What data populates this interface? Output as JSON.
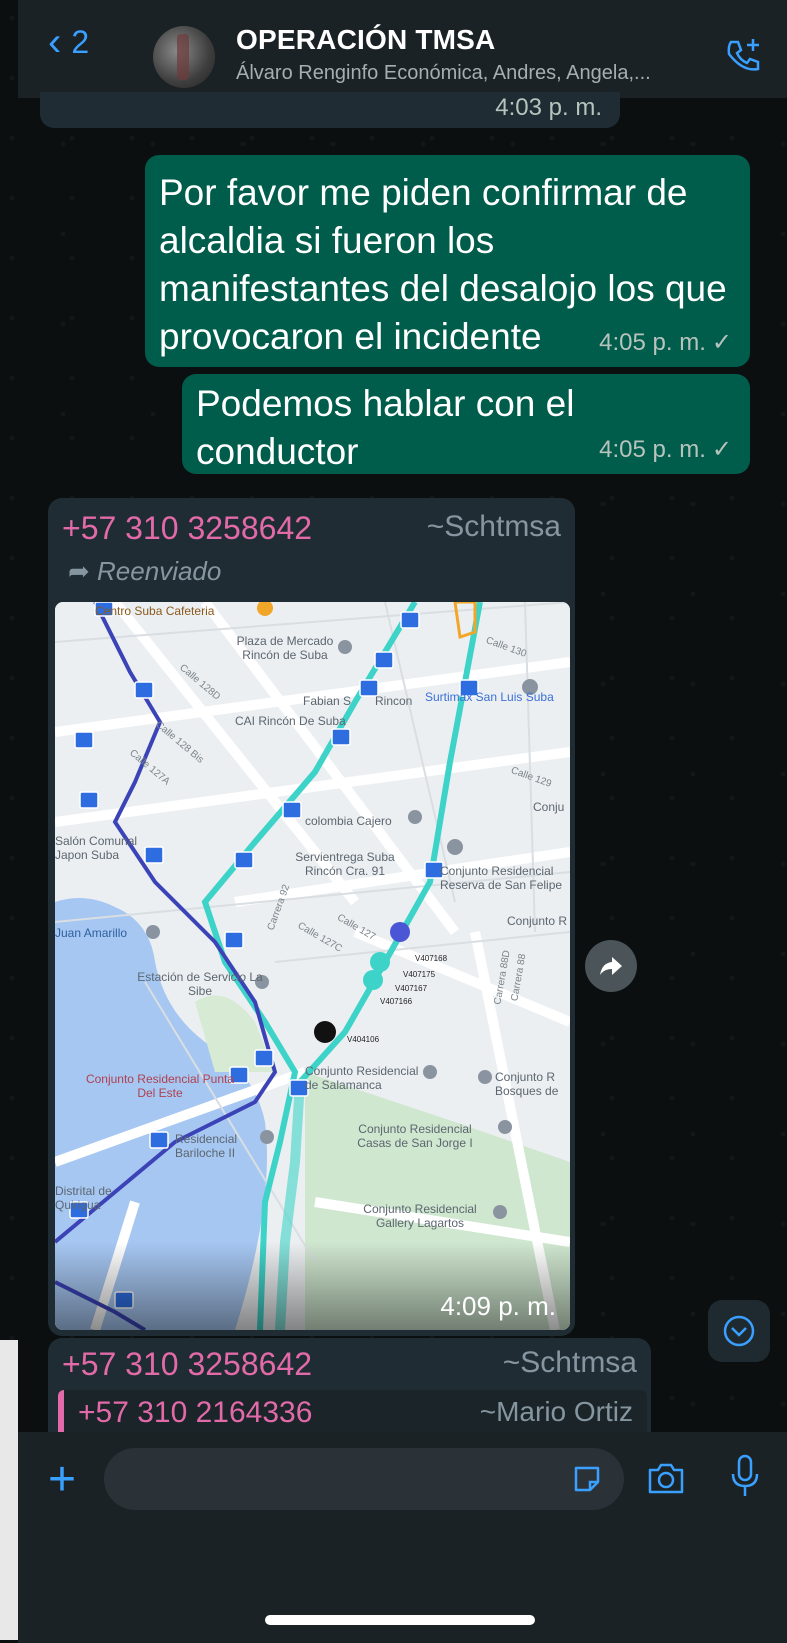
{
  "header": {
    "back_count": "2",
    "title": "OPERACIÓN TMSA",
    "members": "Álvaro Renginfo Económica, Andres, Angela,..."
  },
  "messages": [
    {
      "id": "m0",
      "direction": "in",
      "time": "4:03 p. m."
    },
    {
      "id": "m1",
      "direction": "out",
      "text": "Por favor me piden confirmar de alcaldia si fueron los manifestantes del desalojo los que provocaron el incidente",
      "time": "4:05 p. m.",
      "status": "✓"
    },
    {
      "id": "m2",
      "direction": "out",
      "text": "Podemos hablar con el conductor",
      "time": "4:05 p. m.",
      "status": "✓"
    },
    {
      "id": "m3",
      "direction": "in",
      "sender": "+57 310 3258642",
      "sender_alias": "~Schtmsa",
      "forwarded_label": "Reenviado",
      "time": "4:09 p. m."
    },
    {
      "id": "m4",
      "direction": "in",
      "sender": "+57 310 3258642",
      "sender_alias": "~Schtmsa",
      "quoted_sender": "+57 310 2164336",
      "quoted_alias": "~Mario Ortiz"
    }
  ],
  "map_labels": {
    "l1": "Centro Suba Cafeteria",
    "l2": "Plaza de Mercado Rincón de Suba",
    "l3": "Fabian S",
    "l4": "Rincon",
    "l5": "CAI Rincón De Suba",
    "l6": "Surtimax San Luis Suba",
    "l7": "colombia Cajero",
    "l8": "Servientrega Suba Rincón Cra. 91",
    "l9": "Conjunto Residencial Reserva de San Felipe",
    "l10": "Salón Comunal Japon Suba",
    "l11": "Juan Amarillo",
    "l12": "Estación de Servicio La Sibe",
    "l13": "Conjunto Residencial Punta Del Este",
    "l14": "Conjunto Residencial de Salamanca",
    "l15": "Conjunto R Bosques de",
    "l16": "Residencial Bariloche II",
    "l17": "Conjunto Residencial Casas de San Jorge I",
    "l18": "Conjunto Residencial Gallery Lagartos",
    "l19": "Distrital de Quirigua",
    "l20": "Conjunto R",
    "l21": "Conju",
    "l22": "Calle 130",
    "l23": "Calle 129",
    "l24": "Calle 128D",
    "l25": "Calle 128 Bis",
    "l26": "Calle 127A",
    "l27": "Carrera 92",
    "l28": "Calle 127C",
    "l29": "Calle 127",
    "l30": "Carrera 88D",
    "l31": "Carrera 88"
  },
  "vehicle_ids": [
    "V407168",
    "V407175",
    "V407167",
    "V407166",
    "V404106"
  ],
  "composer": {
    "placeholder": ""
  },
  "colors": {
    "accent": "#3aa0ff",
    "outgoing": "#005c4b",
    "incoming": "#202c33",
    "sender": "#e26aa9",
    "route_teal": "#3ed3c8",
    "route_blue": "#3b43b7"
  }
}
